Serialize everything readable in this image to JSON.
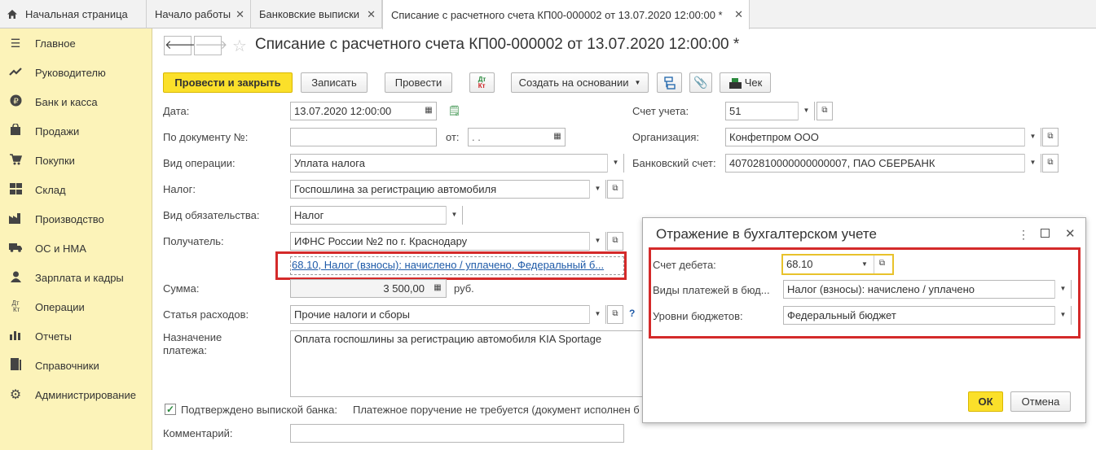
{
  "tabs": {
    "home": "Начальная страница",
    "start": "Начало работы",
    "bank": "Банковские выписки",
    "doc": "Списание с расчетного счета КП00-000002 от 13.07.2020 12:00:00 *"
  },
  "sidebar": {
    "items": [
      {
        "label": "Главное",
        "icon": "menu-icon"
      },
      {
        "label": "Руководителю",
        "icon": "chart-trend-icon"
      },
      {
        "label": "Банк и касса",
        "icon": "ruble-icon"
      },
      {
        "label": "Продажи",
        "icon": "shopping-bag-icon"
      },
      {
        "label": "Покупки",
        "icon": "cart-icon"
      },
      {
        "label": "Склад",
        "icon": "warehouse-icon"
      },
      {
        "label": "Производство",
        "icon": "factory-icon"
      },
      {
        "label": "ОС и НМА",
        "icon": "truck-icon"
      },
      {
        "label": "Зарплата и кадры",
        "icon": "person-icon"
      },
      {
        "label": "Операции",
        "icon": "dt-kt-icon"
      },
      {
        "label": "Отчеты",
        "icon": "bar-chart-icon"
      },
      {
        "label": "Справочники",
        "icon": "book-icon"
      },
      {
        "label": "Администрирование",
        "icon": "gear-icon"
      }
    ]
  },
  "header": {
    "title": "Списание с расчетного счета КП00-000002 от 13.07.2020 12:00:00 *"
  },
  "toolbar": {
    "post_close": "Провести и закрыть",
    "save": "Записать",
    "post": "Провести",
    "dtkt": "Дт Кт",
    "create_based": "Создать на основании",
    "check": "Чек"
  },
  "form": {
    "date_label": "Дата:",
    "date_value": "13.07.2020 12:00:00",
    "docnum_label": "По документу №:",
    "docnum_value": "",
    "from_label": "от:",
    "from_value": ". .",
    "optype_label": "Вид операции:",
    "optype_value": "Уплата налога",
    "tax_label": "Налог:",
    "tax_value": "Госпошлина за регистрацию автомобиля",
    "obligation_label": "Вид обязательства:",
    "obligation_value": "Налог",
    "recipient_label": "Получатель:",
    "recipient_value": "ИФНС России №2 по г. Краснодару",
    "account_link": "68.10, Налог (взносы): начислено / уплачено, Федеральный б...",
    "sum_label": "Сумма:",
    "sum_value": "3 500,00",
    "sum_currency": "руб.",
    "expense_label": "Статья расходов:",
    "expense_value": "Прочие налоги и сборы",
    "expense_help": "?",
    "purpose_label": "Назначение платежа:",
    "purpose_value": "Оплата госпошлины за регистрацию автомобиля KIA Sportage",
    "confirmed_label": "Подтверждено выпиской банка:",
    "confirmed_checked": true,
    "payment_order_text": "Платежное поручение не требуется (документ исполнен б",
    "comment_label": "Комментарий:",
    "comment_value": "",
    "acc_label": "Счет учета:",
    "acc_value": "51",
    "org_label": "Организация:",
    "org_value": "Конфетпром ООО",
    "bankacc_label": "Банковский счет:",
    "bankacc_value": "40702810000000000007, ПАО СБЕРБАНК"
  },
  "dialog": {
    "title": "Отражение в бухгалтерском учете",
    "debit_label": "Счет дебета:",
    "debit_value": "68.10",
    "paytype_label": "Виды платежей в бюд...",
    "paytype_value": "Налог (взносы): начислено / уплачено",
    "budget_label": "Уровни бюджетов:",
    "budget_value": "Федеральный бюджет",
    "ok": "ОК",
    "cancel": "Отмена"
  },
  "colors": {
    "sidebar_bg": "#fcf3b9",
    "primary_button": "#fbe02a",
    "highlight_red": "#d42a2a",
    "link": "#1e5aa8"
  }
}
